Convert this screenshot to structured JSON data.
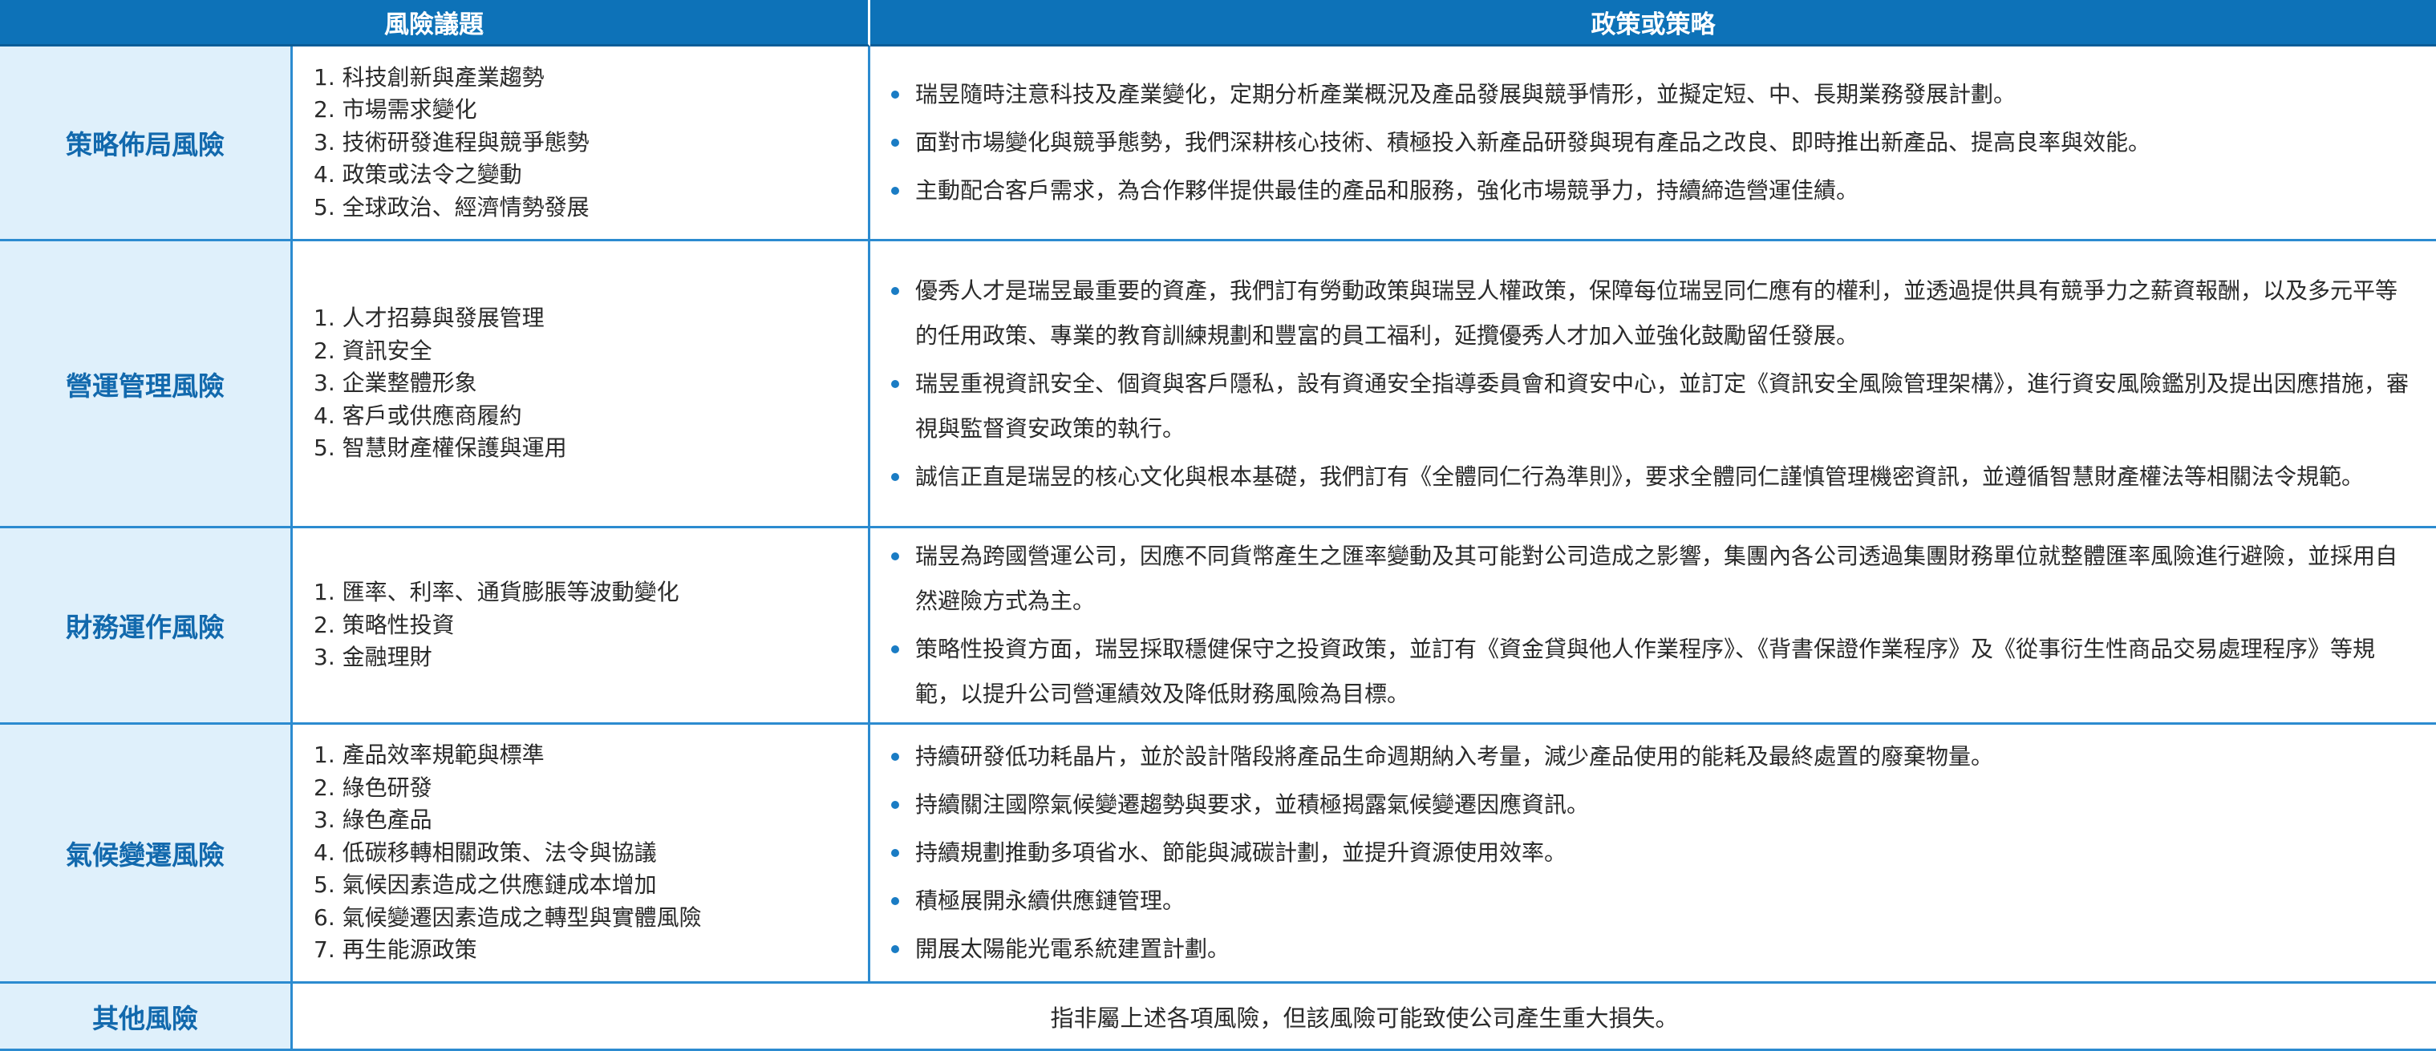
{
  "header": {
    "issue_label": "風險議題",
    "policy_label": "政策或策略"
  },
  "rows": [
    {
      "category": "策略佈局風險",
      "issues": [
        "1. 科技創新與產業趨勢",
        "2. 市場需求變化",
        "3. 技術研發進程與競爭態勢",
        "4. 政策或法令之變動",
        "5. 全球政治、經濟情勢發展"
      ],
      "policies": [
        "瑞昱隨時注意科技及產業變化，定期分析產業概況及產品發展與競爭情形，並擬定短、中、長期業務發展計劃。",
        "面對市場變化與競爭態勢，我們深耕核心技術、積極投入新產品研發與現有產品之改良、即時推出新產品、提高良率與效能。",
        "主動配合客戶需求，為合作夥伴提供最佳的產品和服務，強化市場競爭力，持續締造營運佳績。"
      ]
    },
    {
      "category": "營運管理風險",
      "issues": [
        "1.  人才招募與發展管理",
        "2. 資訊安全",
        "3. 企業整體形象",
        "4. 客戶或供應商履約",
        "5. 智慧財產權保護與運用"
      ],
      "policies": [
        "優秀人才是瑞昱最重要的資產，我們訂有勞動政策與瑞昱人權政策，保障每位瑞昱同仁應有的權利，並透過提供具有競爭力之薪資報酬，以及多元平等的任用政策、專業的教育訓練規劃和豐富的員工福利，延攬優秀人才加入並強化鼓勵留任發展。",
        "瑞昱重視資訊安全、個資與客戶隱私，設有資通安全指導委員會和資安中心，並訂定《資訊安全風險管理架構》，進行資安風險鑑別及提出因應措施，審視與監督資安政策的執行。",
        "誠信正直是瑞昱的核心文化與根本基礎，我們訂有《全體同仁行為準則》，要求全體同仁謹慎管理機密資訊，並遵循智慧財產權法等相關法令規範。"
      ]
    },
    {
      "category": "財務運作風險",
      "issues": [
        "1.  匯率、利率、通貨膨脹等波動變化",
        "2. 策略性投資",
        "3. 金融理財"
      ],
      "policies": [
        "瑞昱為跨國營運公司，因應不同貨幣產生之匯率變動及其可能對公司造成之影響，集團內各公司透過集團財務單位就整體匯率風險進行避險，並採用自然避險方式為主。",
        "策略性投資方面，瑞昱採取穩健保守之投資政策，並訂有《資金貸與他人作業程序》、《背書保證作業程序》及《從事衍生性商品交易處理程序》等規範，以提升公司營運績效及降低財務風險為目標。"
      ]
    },
    {
      "category": "氣候變遷風險",
      "issues": [
        "1. 產品效率規範與標準",
        "2. 綠色研發",
        "3. 綠色產品",
        "4. 低碳移轉相關政策、法令與協議",
        "5. 氣候因素造成之供應鏈成本增加",
        "6. 氣候變遷因素造成之轉型與實體風險",
        "7. 再生能源政策"
      ],
      "policies": [
        "持續研發低功耗晶片，並於設計階段將產品生命週期納入考量，減少產品使用的能耗及最終處置的廢棄物量。",
        "持續關注國際氣候變遷趨勢與要求，並積極揭露氣候變遷因應資訊。",
        "持續規劃推動多項省水、節能與減碳計劃，並提升資源使用效率。",
        "積極展開永續供應鏈管理。",
        "開展太陽能光電系統建置計劃。"
      ]
    }
  ],
  "other": {
    "category": "其他風險",
    "description": "指非屬上述各項風險，但該風險可能致使公司產生重大損失。"
  }
}
